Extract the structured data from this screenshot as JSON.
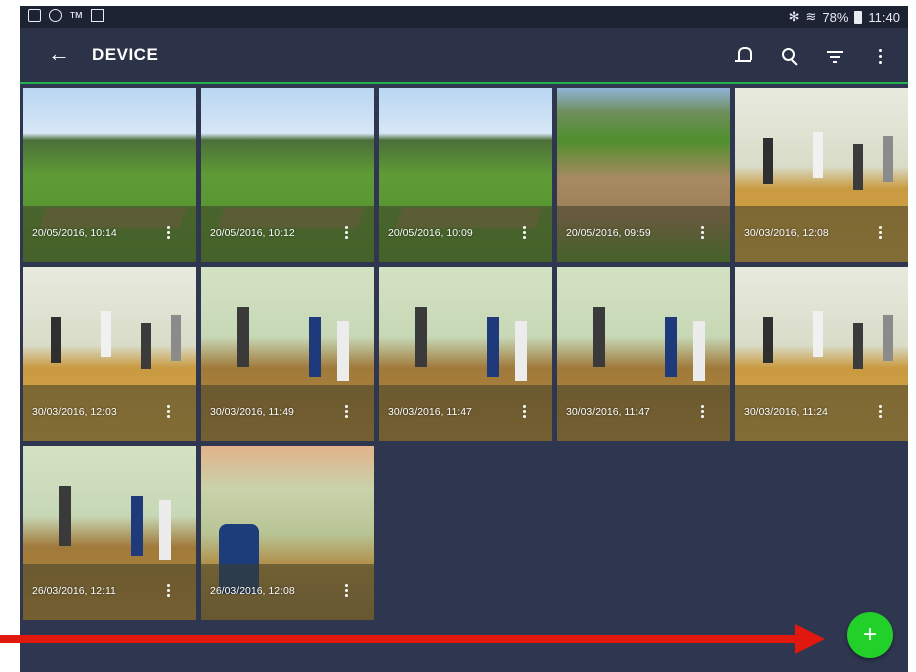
{
  "status_bar": {
    "left_icons": [
      "gallery-icon",
      "face-icon",
      "tm-icon",
      "mail-icon"
    ],
    "tm_glyph": "ᴛᴍ",
    "bluetooth": "✻",
    "wifi": "≋",
    "battery": "78%",
    "time": "11:40"
  },
  "app_bar": {
    "back_glyph": "←",
    "title": "DEVICE"
  },
  "photos": [
    {
      "date": "20/05/2016, 10:14",
      "scene": "outdoor"
    },
    {
      "date": "20/05/2016, 10:12",
      "scene": "outdoor"
    },
    {
      "date": "20/05/2016, 10:09",
      "scene": "outdoor"
    },
    {
      "date": "20/05/2016, 09:59",
      "scene": "field"
    },
    {
      "date": "30/03/2016, 12:08",
      "scene": "gym"
    },
    {
      "date": "30/03/2016, 12:03",
      "scene": "gym"
    },
    {
      "date": "30/03/2016, 11:49",
      "scene": "gym2"
    },
    {
      "date": "30/03/2016, 11:47",
      "scene": "gym2"
    },
    {
      "date": "30/03/2016, 11:47",
      "scene": "gym2"
    },
    {
      "date": "30/03/2016, 11:24",
      "scene": "gym"
    },
    {
      "date": "26/03/2016, 12:11",
      "scene": "gym2"
    },
    {
      "date": "26/03/2016, 12:08",
      "scene": "gym3"
    }
  ],
  "fab": {
    "label": "+",
    "color": "#22d02a"
  },
  "annotation": {
    "color": "#e0180e"
  }
}
